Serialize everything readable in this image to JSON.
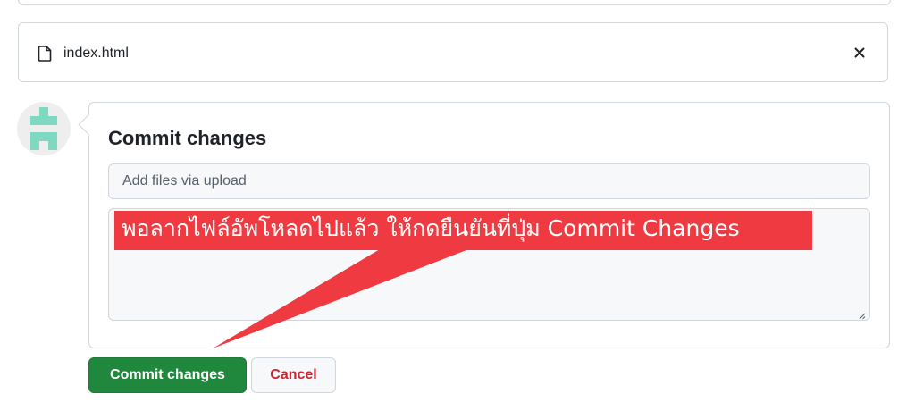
{
  "file": {
    "name": "index.html",
    "icon": "file-icon",
    "close_icon": "close-icon"
  },
  "avatar": {
    "icon": "identicon",
    "color": "#7fd9c0"
  },
  "commit_form": {
    "title": "Commit changes",
    "summary_placeholder": "Add files via upload",
    "description_value": ""
  },
  "buttons": {
    "commit_label": "Commit changes",
    "cancel_label": "Cancel"
  },
  "annotation": {
    "text": "พอลากไฟล์อัพโหลดไปแล้ว ให้กดยืนยันที่ปุ่ม Commit  Changes",
    "color": "#ee3a40"
  },
  "colors": {
    "primary_button": "#1f883d",
    "danger_text": "#cf222e",
    "border": "#d0d7de"
  }
}
